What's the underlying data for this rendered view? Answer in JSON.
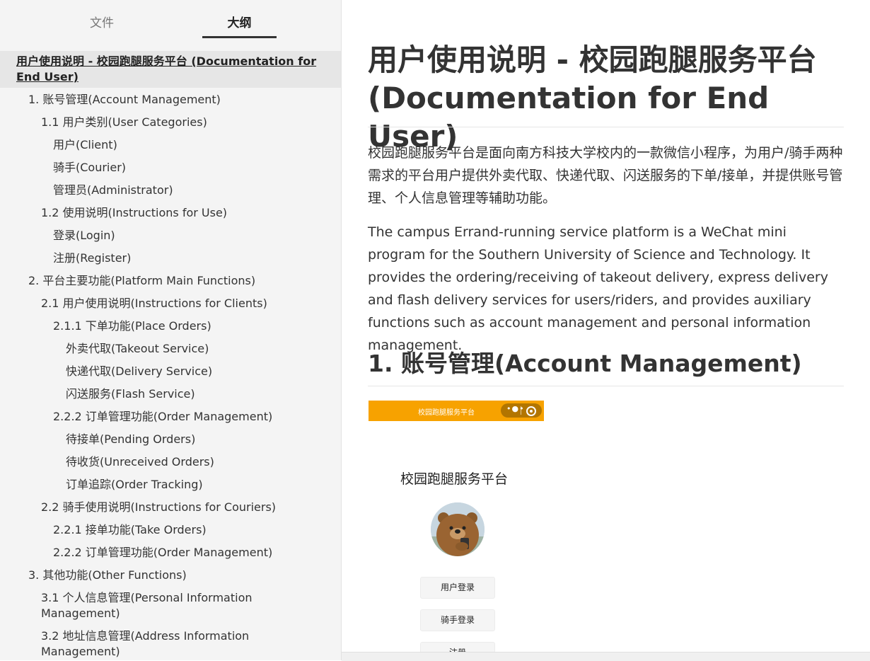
{
  "sidebar": {
    "tabs": {
      "files": "文件",
      "outline": "大纲"
    },
    "active_item": "用户使用说明 - 校园跑腿服务平台 (Documentation for End User)",
    "items": [
      "1. 账号管理(Account Management)",
      "1.1 用户类别(User Categories)",
      "用户(Client)",
      "骑手(Courier)",
      "管理员(Administrator)",
      "1.2 使用说明(Instructions for Use)",
      "登录(Login)",
      "注册(Register)",
      "2. 平台主要功能(Platform Main Functions)",
      "2.1 用户使用说明(Instructions for Clients)",
      "2.1.1 下单功能(Place Orders)",
      "外卖代取(Takeout Service)",
      "快递代取(Delivery Service)",
      "闪送服务(Flash Service)",
      "2.2.2 订单管理功能(Order Management)",
      "待接单(Pending Orders)",
      "待收货(Unreceived Orders)",
      "订单追踪(Order Tracking)",
      "2.2 骑手使用说明(Instructions for Couriers)",
      "2.2.1 接单功能(Take Orders)",
      "2.2.2 订单管理功能(Order Management)",
      "3. 其他功能(Other Functions)",
      "3.1 个人信息管理(Personal Information Management)",
      "3.2 地址信息管理(Address Information Management)"
    ]
  },
  "content": {
    "title": "用户使用说明 - 校园跑腿服务平台 (Documentation for End User)",
    "intro_cn": "校园跑腿服务平台是面向南方科技大学校内的一款微信小程序，为用户/骑手两种需求的平台用户提供外卖代取、快递代取、闪送服务的下单/接单，并提供账号管理、个人信息管理等辅助功能。",
    "intro_en": "The campus Errand-running service platform is a WeChat mini program for the Southern University of Science and Technology. It provides the ordering/receiving of takeout delivery, express delivery and flash delivery services for users/riders, and provides auxiliary functions such as account management and personal information management.",
    "section1": "1. 账号管理(Account Management)"
  },
  "screenshot": {
    "bar_title": "校园跑腿服务平台",
    "accent_color": "#f7a200",
    "heading": "校园跑腿服务平台",
    "buttons": [
      "用户登录",
      "骑手登录",
      "注册"
    ]
  }
}
